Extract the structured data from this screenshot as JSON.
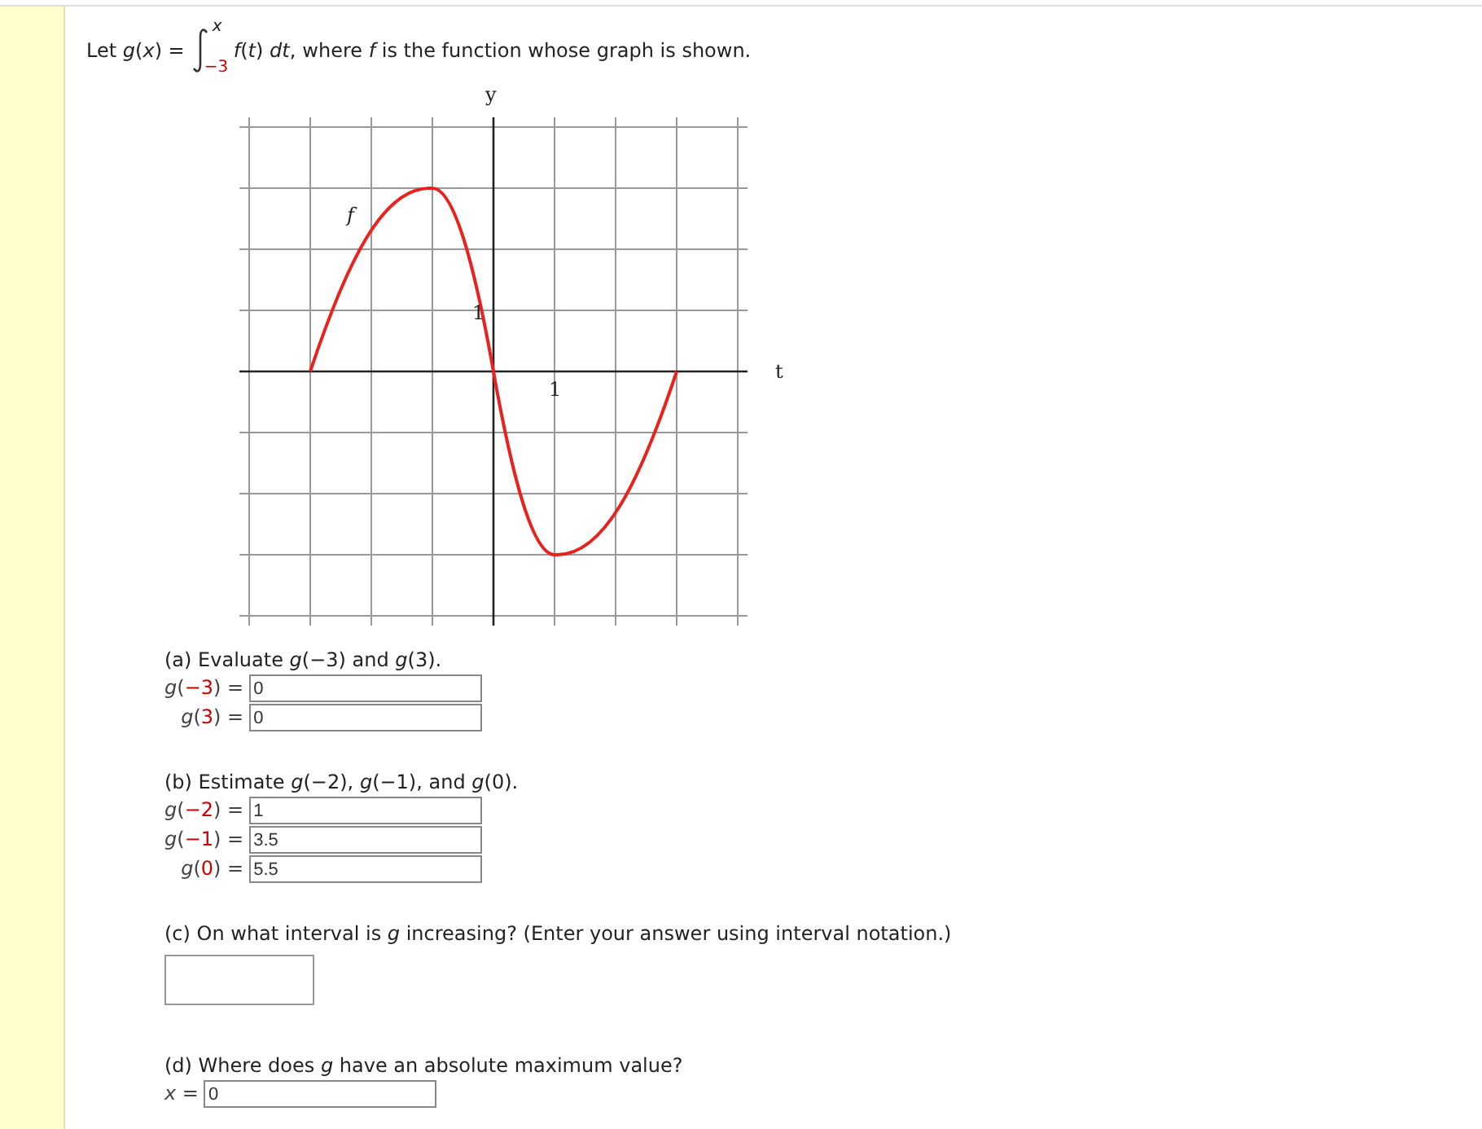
{
  "problem": {
    "prefix": "Let *g*(*x*) =",
    "integral_upper": "x",
    "integral_lower": "−3",
    "integrand": "*f*(*t*) *dt*,",
    "suffix": "where *f* is the function whose graph is shown."
  },
  "graph": {
    "y_axis_label": "y",
    "x_axis_label": "t",
    "y_tick_label": "1",
    "x_tick_label": "1",
    "curve_label": "f"
  },
  "parts": [
    {
      "kind": "rows",
      "heading": "(a) Evaluate *g*(−3) and *g*(3).",
      "answers": [
        {
          "label_start": "*g*(",
          "arg": "−3",
          "label_end": ") =",
          "value": "0"
        },
        {
          "label_start": "*g*(",
          "arg": "3",
          "label_end": ") =",
          "value": "0"
        }
      ]
    },
    {
      "kind": "rows",
      "heading": "(b) Estimate *g*(−2), *g*(−1), and *g*(0).",
      "answers": [
        {
          "label_start": "*g*(",
          "arg": "−2",
          "label_end": ") =",
          "value": "1"
        },
        {
          "label_start": "*g*(",
          "arg": "−1",
          "label_end": ") =",
          "value": "3.5"
        },
        {
          "label_start": "*g*(",
          "arg": "0",
          "label_end": ") =",
          "value": "5.5"
        }
      ]
    },
    {
      "kind": "box",
      "heading": "(c) On what interval is *g* increasing? (Enter your answer using interval notation.)"
    },
    {
      "kind": "rows",
      "heading": "(d) Where does *g* have an absolute maximum value?",
      "answers": [
        {
          "label_start": "*x* =",
          "value": "0"
        }
      ]
    }
  ]
}
